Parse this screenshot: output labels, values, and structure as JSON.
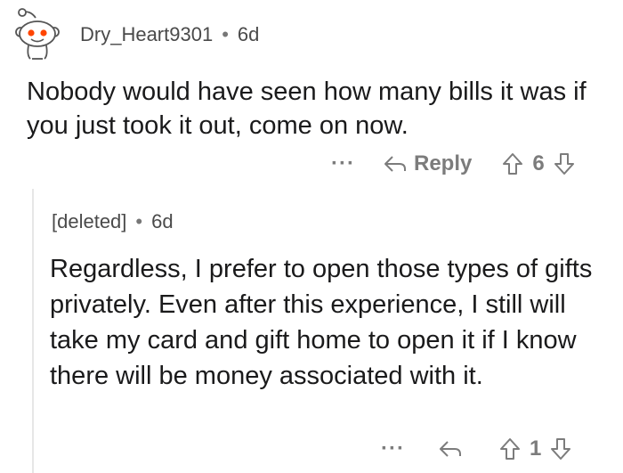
{
  "comment_parent": {
    "username": "Dry_Heart9301",
    "separator": "•",
    "age": "6d",
    "body": "Nobody would have seen how many bills it was if you just took it out, come on now.",
    "actions": {
      "more_label": "···",
      "reply_label": "Reply",
      "vote_count": "6"
    },
    "icons": {
      "avatar": "reddit-snoo-avatar-icon",
      "reply": "reply-arrow-icon",
      "upvote": "upvote-arrow-icon",
      "downvote": "downvote-arrow-icon"
    }
  },
  "comment_reply": {
    "username": "[deleted]",
    "separator": "•",
    "age": "6d",
    "body": "Regardless, I prefer to open those types of gifts privately. Even after this experience, I still will take my card and gift home to open it if I know there will be money associated with it.",
    "actions": {
      "more_label": "···",
      "vote_count": "1"
    }
  },
  "colors": {
    "text": "#1a1a1b",
    "meta": "#4a4a4a",
    "action": "#7c7c7c",
    "thread_line": "#e6e6e6",
    "avatar_accent": "#ff4500"
  }
}
